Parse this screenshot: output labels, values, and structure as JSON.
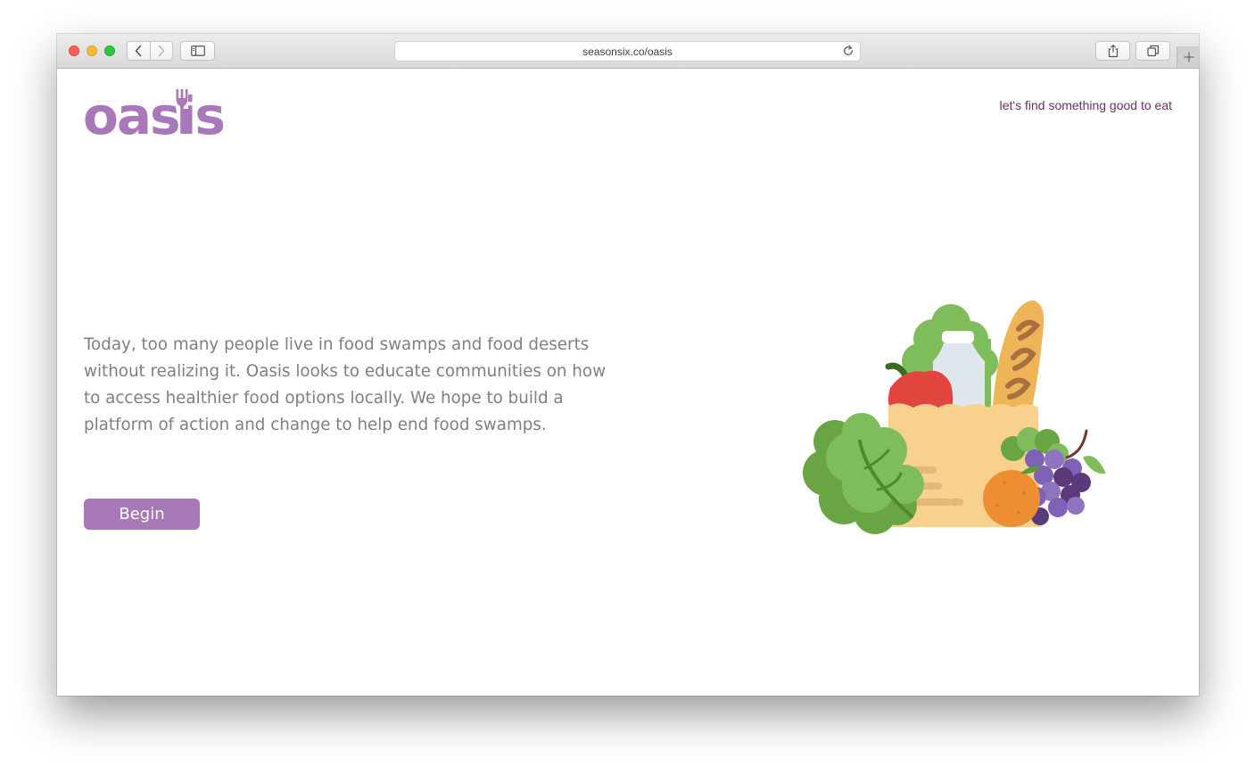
{
  "browser": {
    "url": "seasonsix.co/oasis"
  },
  "header": {
    "logo_text": "oasis",
    "tagline": "let's find something good to eat"
  },
  "main": {
    "intro": "Today, too many people live in food swamps and food deserts without realizing it. Oasis looks to educate communities on how to access healthier food options locally. We hope to build a platform of action and change to help end food swamps.",
    "begin_label": "Begin"
  },
  "colors": {
    "brand": "#a878b9",
    "tagline": "#6b2f6d",
    "body_text": "#7f7f7f"
  },
  "icons": [
    "back-icon",
    "forward-icon",
    "sidebar-icon",
    "reload-icon",
    "share-icon",
    "tabs-icon",
    "plus-icon",
    "fork-icon"
  ]
}
